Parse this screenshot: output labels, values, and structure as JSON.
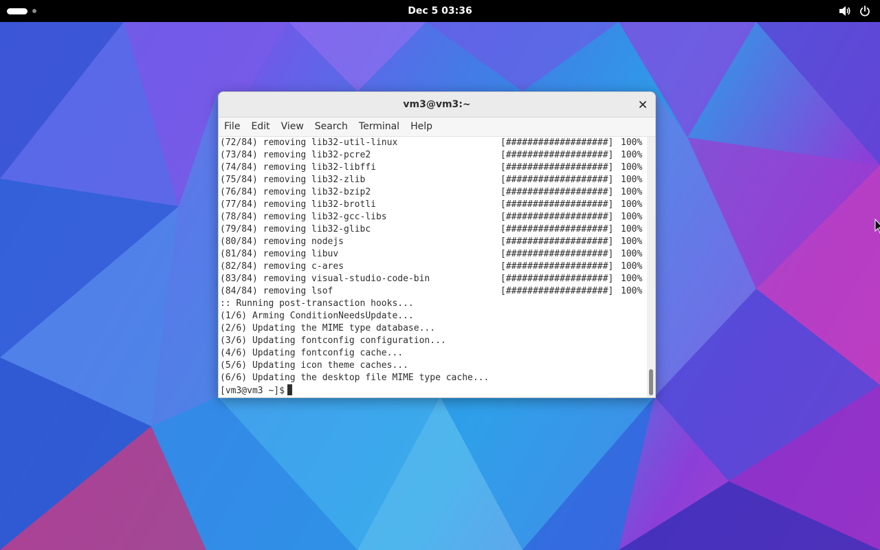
{
  "topbar": {
    "clock": "Dec 5  03:36",
    "icons": [
      "volume-icon",
      "power-icon"
    ]
  },
  "window": {
    "title": "vm3@vm3:~",
    "close_icon": "close-icon"
  },
  "menubar": {
    "items": [
      "File",
      "Edit",
      "View",
      "Search",
      "Terminal",
      "Help"
    ]
  },
  "terminal": {
    "removal_lines": [
      {
        "text": "(72/84) removing lib32-util-linux",
        "bar": "[###################]",
        "pct": "100%"
      },
      {
        "text": "(73/84) removing lib32-pcre2",
        "bar": "[###################]",
        "pct": "100%"
      },
      {
        "text": "(74/84) removing lib32-libffi",
        "bar": "[###################]",
        "pct": "100%"
      },
      {
        "text": "(75/84) removing lib32-zlib",
        "bar": "[###################]",
        "pct": "100%"
      },
      {
        "text": "(76/84) removing lib32-bzip2",
        "bar": "[###################]",
        "pct": "100%"
      },
      {
        "text": "(77/84) removing lib32-brotli",
        "bar": "[###################]",
        "pct": "100%"
      },
      {
        "text": "(78/84) removing lib32-gcc-libs",
        "bar": "[###################]",
        "pct": "100%"
      },
      {
        "text": "(79/84) removing lib32-glibc",
        "bar": "[###################]",
        "pct": "100%"
      },
      {
        "text": "(80/84) removing nodejs",
        "bar": "[###################]",
        "pct": "100%"
      },
      {
        "text": "(81/84) removing libuv",
        "bar": "[###################]",
        "pct": "100%"
      },
      {
        "text": "(82/84) removing c-ares",
        "bar": "[###################]",
        "pct": "100%"
      },
      {
        "text": "(83/84) removing visual-studio-code-bin",
        "bar": "[###################]",
        "pct": "100%"
      },
      {
        "text": "(84/84) removing lsof",
        "bar": "[###################]",
        "pct": "100%"
      }
    ],
    "hook_lines": [
      ":: Running post-transaction hooks...",
      "(1/6) Arming ConditionNeedsUpdate...",
      "(2/6) Updating the MIME type database...",
      "(3/6) Updating fontconfig configuration...",
      "(4/6) Updating fontconfig cache...",
      "(5/6) Updating icon theme caches...",
      "(6/6) Updating the desktop file MIME type cache..."
    ],
    "prompt": "[vm3@vm3 ~]$"
  },
  "colors": {
    "topbar": "#000000",
    "terminal_bg": "#ffffff",
    "terminal_fg": "#2e2e2e",
    "titlebar": "#ebebeb"
  }
}
